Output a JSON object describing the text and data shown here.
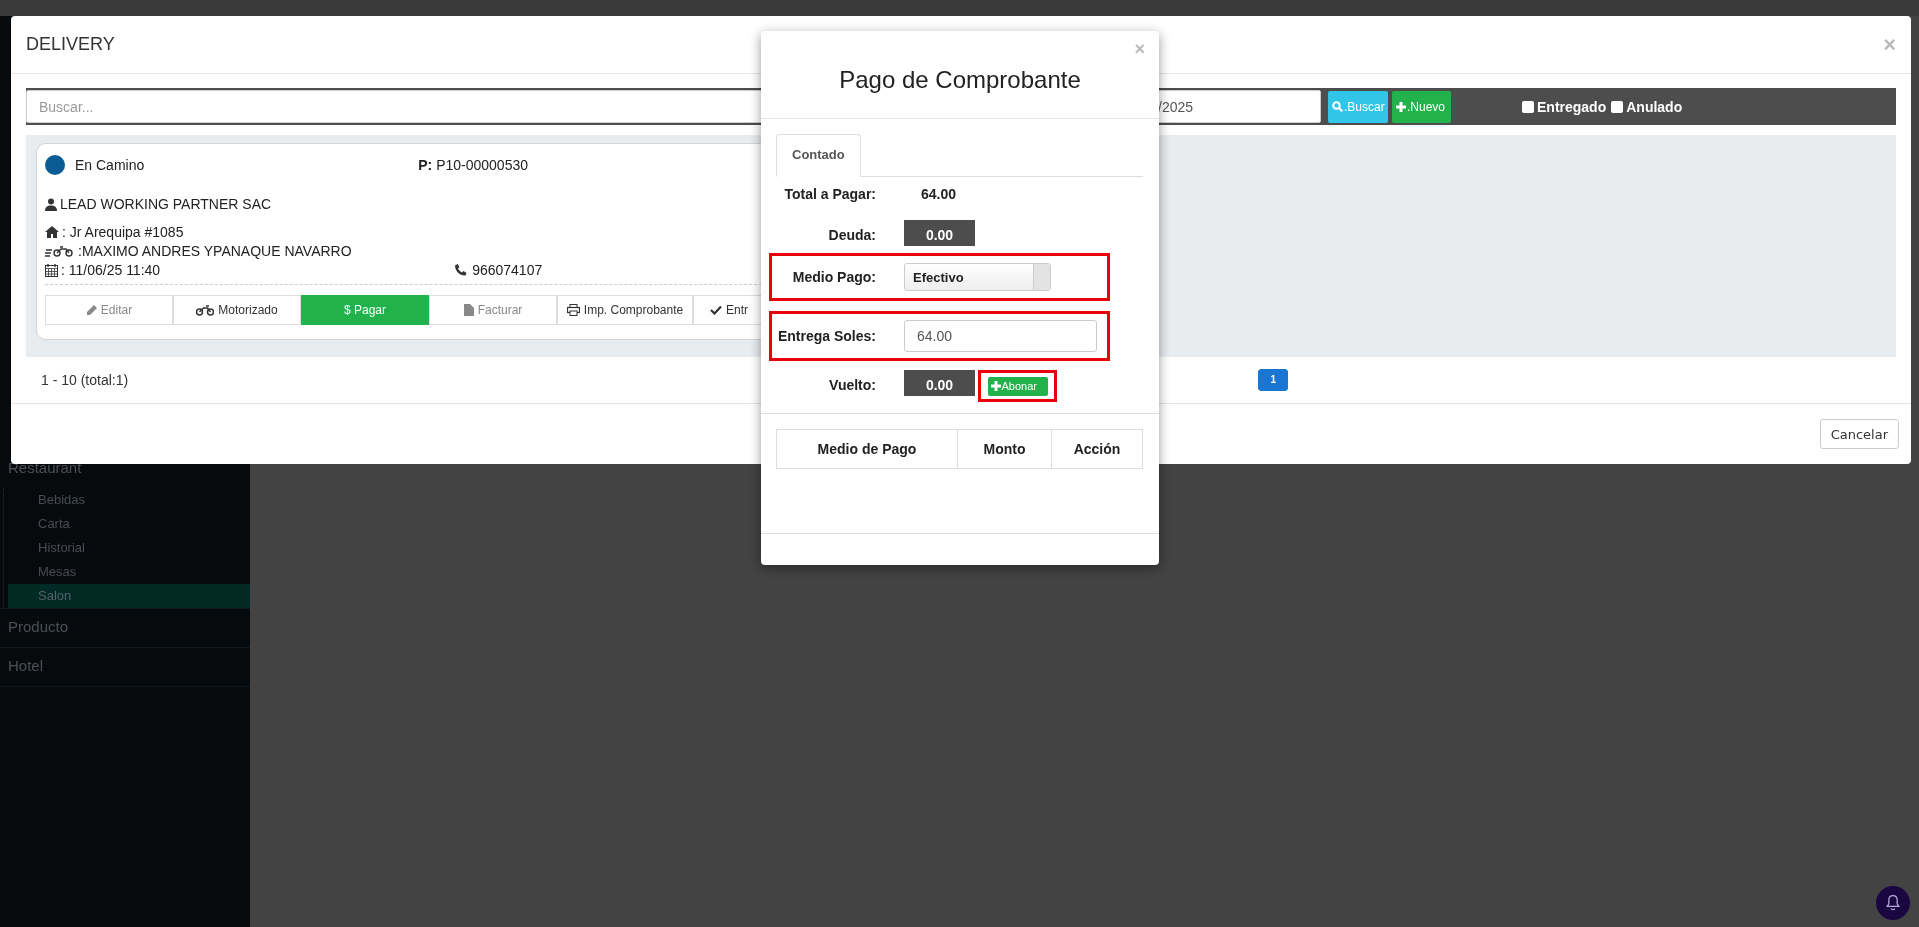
{
  "sidebar": {
    "items": [
      {
        "label": "Restaurant",
        "children": [
          {
            "label": "Bebidas",
            "selected": false
          },
          {
            "label": "Carta",
            "selected": false
          },
          {
            "label": "Historial",
            "selected": false
          },
          {
            "label": "Mesas",
            "selected": false
          },
          {
            "label": "Salon",
            "selected": true
          }
        ]
      },
      {
        "label": "Producto"
      },
      {
        "label": "Hotel"
      }
    ]
  },
  "delivery_dialog": {
    "title": "DELIVERY",
    "close": "×",
    "search": {
      "placeholder": "Buscar..."
    },
    "date_field": {
      "value": "/2025"
    },
    "buttons": [
      {
        "label": ".Buscar",
        "kind": "search"
      },
      {
        "label": ".Nuevo",
        "kind": "new"
      }
    ],
    "filters": [
      {
        "label": "Entregado",
        "checked": false
      },
      {
        "label": "Anulado",
        "checked": false
      }
    ],
    "orders": [
      {
        "status": "En Camino",
        "color": "#0b5c94",
        "code": "**P:** P10-00000530",
        "customer": "LEAD WORKING PARTNER SAC",
        "address": ": Jr Arequipa #1085",
        "driver": ":MAXIMO ANDRES YPANAQUE NAVARRO",
        "date": ": 11/06/25 11:40",
        "phone": "966074107",
        "actions": [
          {
            "label": "Editar",
            "kind": "edit",
            "disabled": true
          },
          {
            "label": "Motorizado",
            "kind": "driver",
            "disabled": false
          },
          {
            "label": "$ Pagar",
            "kind": "pay",
            "disabled": false
          },
          {
            "label": "Facturar",
            "kind": "invoice",
            "disabled": true
          },
          {
            "label": "Imp. Comprobante",
            "kind": "print",
            "disabled": false
          },
          {
            "label": "Entr",
            "kind": "deliver",
            "disabled": false
          }
        ]
      }
    ],
    "range": "1 - 10 (total:1)",
    "pages": [
      {
        "label": "1",
        "selected": true
      }
    ],
    "cancel": "Cancelar"
  },
  "payment_dialog": {
    "title": "Pago de Comprobante",
    "close": "×",
    "tabs": [
      {
        "label": "Contado",
        "selected": true
      }
    ],
    "rows": [
      {
        "label": "Total a Pagar:",
        "kind": "text",
        "value": "64.00"
      },
      {
        "label": "Deuda:",
        "kind": "readout",
        "value": "0.00"
      },
      {
        "label": "Medio Pago:",
        "kind": "select",
        "value": "Efectivo",
        "highlighted": true
      },
      {
        "label": "Entrega Soles:",
        "kind": "input",
        "value": "64.00",
        "highlighted": true
      },
      {
        "label": "Vuelto:",
        "kind": "readout",
        "value": "0.00"
      }
    ],
    "add_button": {
      "label": "Abonar",
      "highlighted": true
    },
    "table": {
      "columns": [
        "Medio de Pago",
        "Monto",
        "Acción"
      ]
    }
  }
}
